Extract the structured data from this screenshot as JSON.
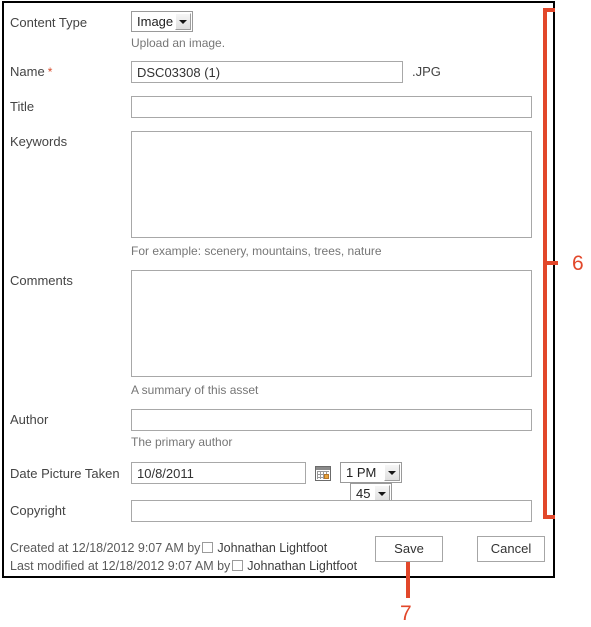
{
  "form": {
    "fields": {
      "content_type": {
        "label": "Content Type",
        "selected": "Image",
        "hint": "Upload an image."
      },
      "name": {
        "label": "Name",
        "required_marker": "*",
        "value": "DSC03308 (1)",
        "extension": ".JPG"
      },
      "title": {
        "label": "Title",
        "value": ""
      },
      "keywords": {
        "label": "Keywords",
        "value": "",
        "hint": "For example: scenery, mountains, trees, nature"
      },
      "comments": {
        "label": "Comments",
        "value": "",
        "hint": "A summary of this asset"
      },
      "author": {
        "label": "Author",
        "value": "",
        "hint": "The primary author"
      },
      "date_picture_taken": {
        "label": "Date Picture Taken",
        "date_value": "10/8/2011",
        "calendar_icon": "calendar-icon",
        "hour": "1 PM",
        "minute": "45"
      },
      "copyright": {
        "label": "Copyright",
        "value": ""
      }
    },
    "meta": {
      "created": {
        "prefix": "Created at 12/18/2012 9:07 AM  by",
        "user": "Johnathan Lightfoot"
      },
      "modified": {
        "prefix": "Last modified at 12/18/2012 9:07 AM  by",
        "user": "Johnathan Lightfoot"
      }
    },
    "buttons": {
      "save": "Save",
      "cancel": "Cancel"
    }
  },
  "annotations": {
    "bracket_label": "6",
    "pointer_label": "7",
    "color": "#e2472a"
  }
}
